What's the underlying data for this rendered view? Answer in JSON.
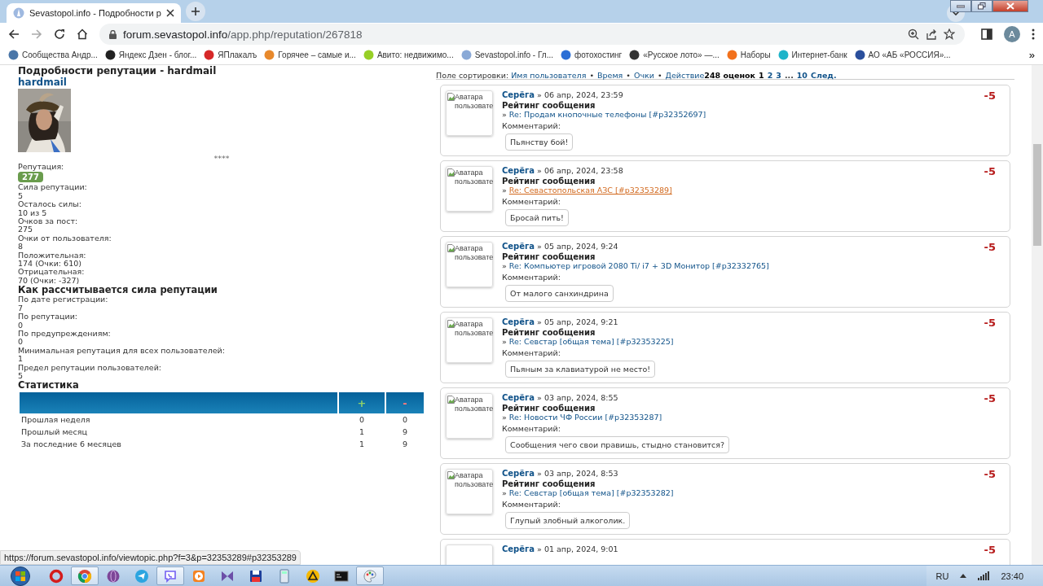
{
  "browser": {
    "tab_title": "Sevastopol.info - Подробности р",
    "url_host": "forum.sevastopol.info",
    "url_path": "/app.php/reputation/267818",
    "profile_initial": "A",
    "bookmarks_more": "»",
    "bookmarks": [
      {
        "label": "Сообщества Андр...",
        "color": "#4a76a8"
      },
      {
        "label": "Яндекс Дзен - блог...",
        "color": "#222222"
      },
      {
        "label": "ЯПлакалъ",
        "color": "#d62828"
      },
      {
        "label": "Горячее – самые и...",
        "color": "#e8892c"
      },
      {
        "label": "Авито: недвижимо...",
        "color": "#97cf26"
      },
      {
        "label": "Sevastopol.info - Гл...",
        "color": "#8aa9d6"
      },
      {
        "label": "фотохостинг",
        "color": "#2b6fd6"
      },
      {
        "label": "«Русское лото» —...",
        "color": "#333333"
      },
      {
        "label": "Наборы",
        "color": "#f2711c"
      },
      {
        "label": "Интернет-банк",
        "color": "#1fb4c9"
      },
      {
        "label": "АО «АБ «РОССИЯ»...",
        "color": "#2a4f9c"
      }
    ]
  },
  "profile": {
    "heading": "Подробности репутации - hardmail",
    "username": "hardmail",
    "stars": "****",
    "reputation_label": "Репутация:",
    "reputation": "277",
    "fields": [
      {
        "label": "Сила репутации:",
        "value": "5"
      },
      {
        "label": "Осталось силы:",
        "value": "10 из 5"
      },
      {
        "label": "Очков за пост:",
        "value": "275"
      },
      {
        "label": "Очки от пользователя:",
        "value": "8"
      },
      {
        "label": "Положительная:",
        "value": "174 (Очки: 610)"
      },
      {
        "label": "Отрицательная:",
        "value": "70 (Очки: -327)"
      }
    ],
    "calc_title": "Как рассчитывается сила репутации",
    "calc_fields": [
      {
        "label": "По дате регистрации:",
        "value": "7"
      },
      {
        "label": "По репутации:",
        "value": "0"
      },
      {
        "label": "По предупреждениям:",
        "value": "0"
      },
      {
        "label": "Минимальная репутация для всех пользователей:",
        "value": "1"
      },
      {
        "label": "Предел репутации пользователей:",
        "value": "5"
      }
    ],
    "stats": {
      "title": "Статистика",
      "columns": [
        "+",
        "-"
      ],
      "rows": [
        {
          "label": "Прошлая неделя",
          "plus": "0",
          "minus": "0"
        },
        {
          "label": "Прошлый месяц",
          "plus": "1",
          "minus": "9"
        },
        {
          "label": "За последние 6 месяцев",
          "plus": "1",
          "minus": "9"
        }
      ]
    }
  },
  "sorting": {
    "label": "Поле сортировки:",
    "separator": "•",
    "options": [
      "Имя пользователя",
      "Время",
      "Очки",
      "Действие"
    ],
    "count": "248 оценок",
    "pages": [
      {
        "kind": "page",
        "label": "1",
        "selected": true
      },
      {
        "kind": "page",
        "label": "2",
        "selected": false
      },
      {
        "kind": "page",
        "label": "3",
        "selected": false
      },
      {
        "kind": "gap",
        "label": "...",
        "selected": false
      },
      {
        "kind": "page",
        "label": "10",
        "selected": false
      },
      {
        "kind": "next",
        "label": "След.",
        "selected": false
      }
    ]
  },
  "ratings": [
    {
      "avatar_alt": "Аватара пользовате",
      "user": "Серёга",
      "date": "» 06 апр, 2024, 23:59",
      "title": "Рейтинг сообщения",
      "bullet": "»",
      "link": "Re: Продам кнопочные телефоны [#p32352697]",
      "hovered": false,
      "comment_label": "Комментарий:",
      "comment": "Пьянству бой!",
      "score": "-5"
    },
    {
      "avatar_alt": "Аватара пользовате",
      "user": "Серёга",
      "date": "» 06 апр, 2024, 23:58",
      "title": "Рейтинг сообщения",
      "bullet": "»",
      "link": "Re: Севастопольская АЗС [#p32353289]",
      "hovered": true,
      "comment_label": "Комментарий:",
      "comment": "Бросай пить!",
      "score": "-5"
    },
    {
      "avatar_alt": "Аватара пользовате",
      "user": "Серёга",
      "date": "» 05 апр, 2024, 9:24",
      "title": "Рейтинг сообщения",
      "bullet": "»",
      "link": "Re: Компьютер игровой 2080 Ti/ i7 + 3D Монитор [#p32332765]",
      "hovered": false,
      "comment_label": "Комментарий:",
      "comment": "От малого санхиндрина",
      "score": "-5"
    },
    {
      "avatar_alt": "Аватара пользовате",
      "user": "Серёга",
      "date": "» 05 апр, 2024, 9:21",
      "title": "Рейтинг сообщения",
      "bullet": "»",
      "link": "Re: Севстар [общая тема] [#p32353225]",
      "hovered": false,
      "comment_label": "Комментарий:",
      "comment": "Пьяным за клавиатурой не место!",
      "score": "-5"
    },
    {
      "avatar_alt": "Аватара пользовате",
      "user": "Серёга",
      "date": "» 03 апр, 2024, 8:55",
      "title": "Рейтинг сообщения",
      "bullet": "»",
      "link": "Re: Новости ЧФ России [#p32353287]",
      "hovered": false,
      "comment_label": "Комментарий:",
      "comment": "Сообщения чего свои правишь, стыдно становится?",
      "score": "-5"
    },
    {
      "avatar_alt": "Аватара пользовате",
      "user": "Серёга",
      "date": "» 03 апр, 2024, 8:53",
      "title": "Рейтинг сообщения",
      "bullet": "»",
      "link": "Re: Севстар [общая тема] [#p32353282]",
      "hovered": false,
      "comment_label": "Комментарий:",
      "comment": "Глупый злобный алкоголик.",
      "score": "-5"
    },
    {
      "user": "Серёга",
      "date": "» 01 апр, 2024, 9:01",
      "score": "-5"
    }
  ],
  "status_url": "https://forum.sevastopol.info/viewtopic.php?f=3&p=32353289#p32353289",
  "taskbar": {
    "apps": [
      {
        "kind": "ring",
        "active": false
      },
      {
        "kind": "wheel",
        "active": true
      },
      {
        "kind": "sphere",
        "active": false
      },
      {
        "kind": "plane",
        "active": false
      },
      {
        "kind": "bubble",
        "active": true
      },
      {
        "kind": "play",
        "active": false
      },
      {
        "kind": "bowtie",
        "active": false
      },
      {
        "kind": "floppy",
        "active": false
      },
      {
        "kind": "calculator",
        "active": false
      },
      {
        "kind": "triangle",
        "active": false
      },
      {
        "kind": "terminal",
        "active": false
      },
      {
        "kind": "palette",
        "active": true
      }
    ],
    "language": "RU",
    "clock": "23:40"
  }
}
